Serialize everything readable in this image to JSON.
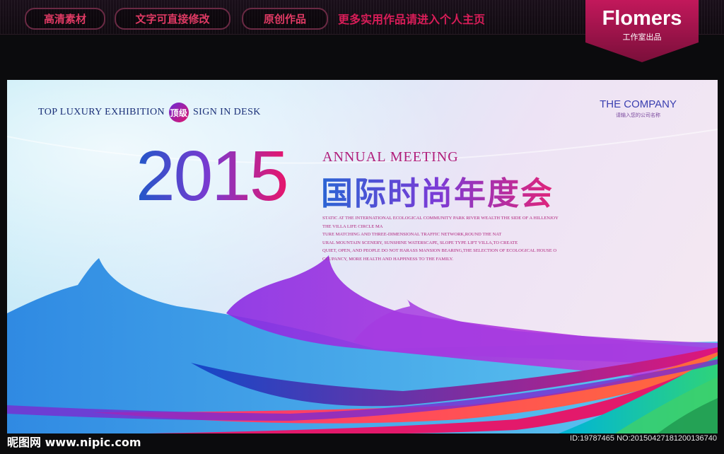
{
  "top_bar": {
    "pills": [
      "高清素材",
      "文字可直接修改",
      "原创作品"
    ],
    "promo": "更多实用作品请进入个人主页"
  },
  "badge": {
    "title": "Flomers",
    "subtitle": "工作室出品"
  },
  "banner": {
    "tagline_part1": "Top luxury exhibition",
    "tagline_badge": "顶级",
    "tagline_part2": "Sign in desk",
    "company_name": "THE COMPANY",
    "company_sub": "请输入您的公司名称",
    "year": "2015",
    "annual": "Annual meeting",
    "title": "国际时尚年度会",
    "description": [
      "STATIC AT THE INTERNATIONAL ECOLOGICAL COMMUNITY PARK RIVER WEALTH THE SIDE OF A HILLENJOY",
      "THE VILLA LIFE CIRCLE MA",
      "TURE MATCHING AND THREE-DIMENSIONAL TRAFFIC NETWORK,ROUND THE NAT",
      "URAL MOUNTAIN SCENERY, SUNSHINE WATERSCAPE, SLOPE TYPE LIFT VILLA,TO CREATE",
      "QUIET, OPEN, AND PEOPLE DO NOT HARASS MANSION BEARING,THE SELECTION OF ECOLOGICAL HOUSE O",
      "CCUPANCY, MORE HEALTH AND HAPPINESS TO THE FAMILY."
    ]
  },
  "footer": {
    "site": "昵图网 www.nipic.com",
    "id_text": "ID:19787465 NO:20150427181200136740"
  }
}
